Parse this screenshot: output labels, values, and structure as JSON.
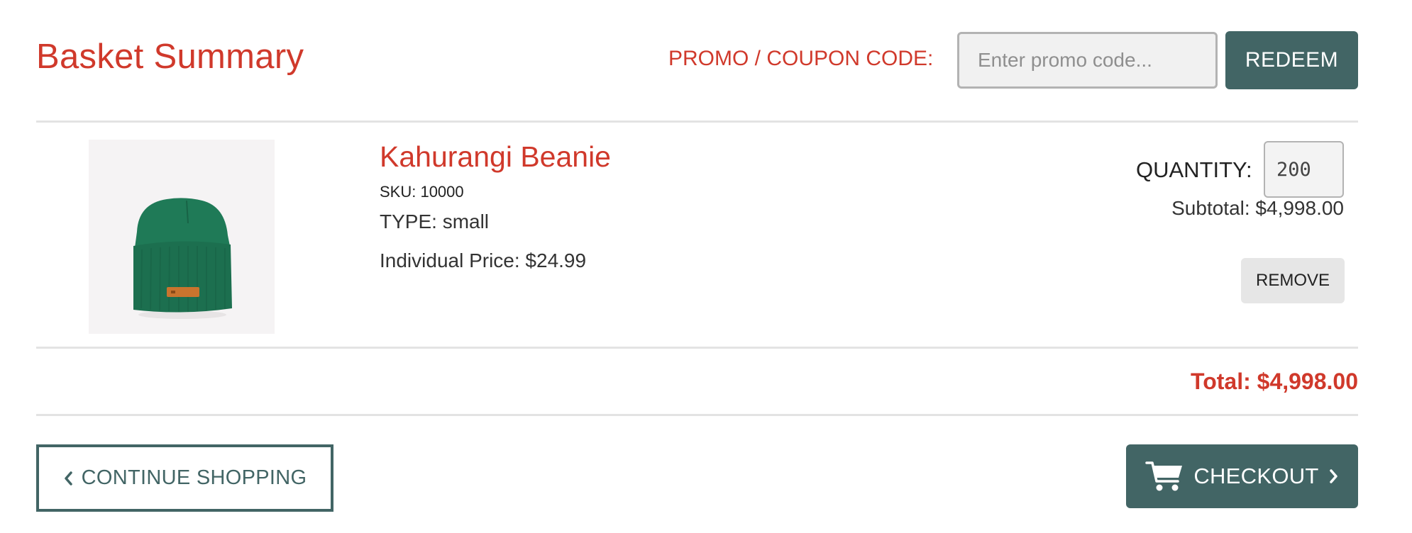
{
  "header": {
    "title": "Basket Summary",
    "promo_label": "PROMO / COUPON CODE:",
    "promo_placeholder": "Enter promo code...",
    "promo_value": "",
    "redeem_label": "REDEEM"
  },
  "item": {
    "name": "Kahurangi Beanie",
    "sku": "SKU: 10000",
    "type": "TYPE: small",
    "individual_price": "Individual Price: $24.99",
    "quantity_label": "QUANTITY:",
    "quantity_value": "200",
    "subtotal": "Subtotal: $4,998.00",
    "remove_label": "REMOVE",
    "image_icon": "beanie-image"
  },
  "summary": {
    "total": "Total: $4,998.00"
  },
  "actions": {
    "continue_label": "CONTINUE SHOPPING",
    "checkout_label": "CHECKOUT",
    "continue_icon": "chevron-left-icon",
    "checkout_icon": "cart-icon"
  },
  "colors": {
    "accent_red": "#d0392b",
    "primary_teal": "#426565",
    "divider": "#e3e3e3",
    "beanie_green": "#1f7a57"
  }
}
